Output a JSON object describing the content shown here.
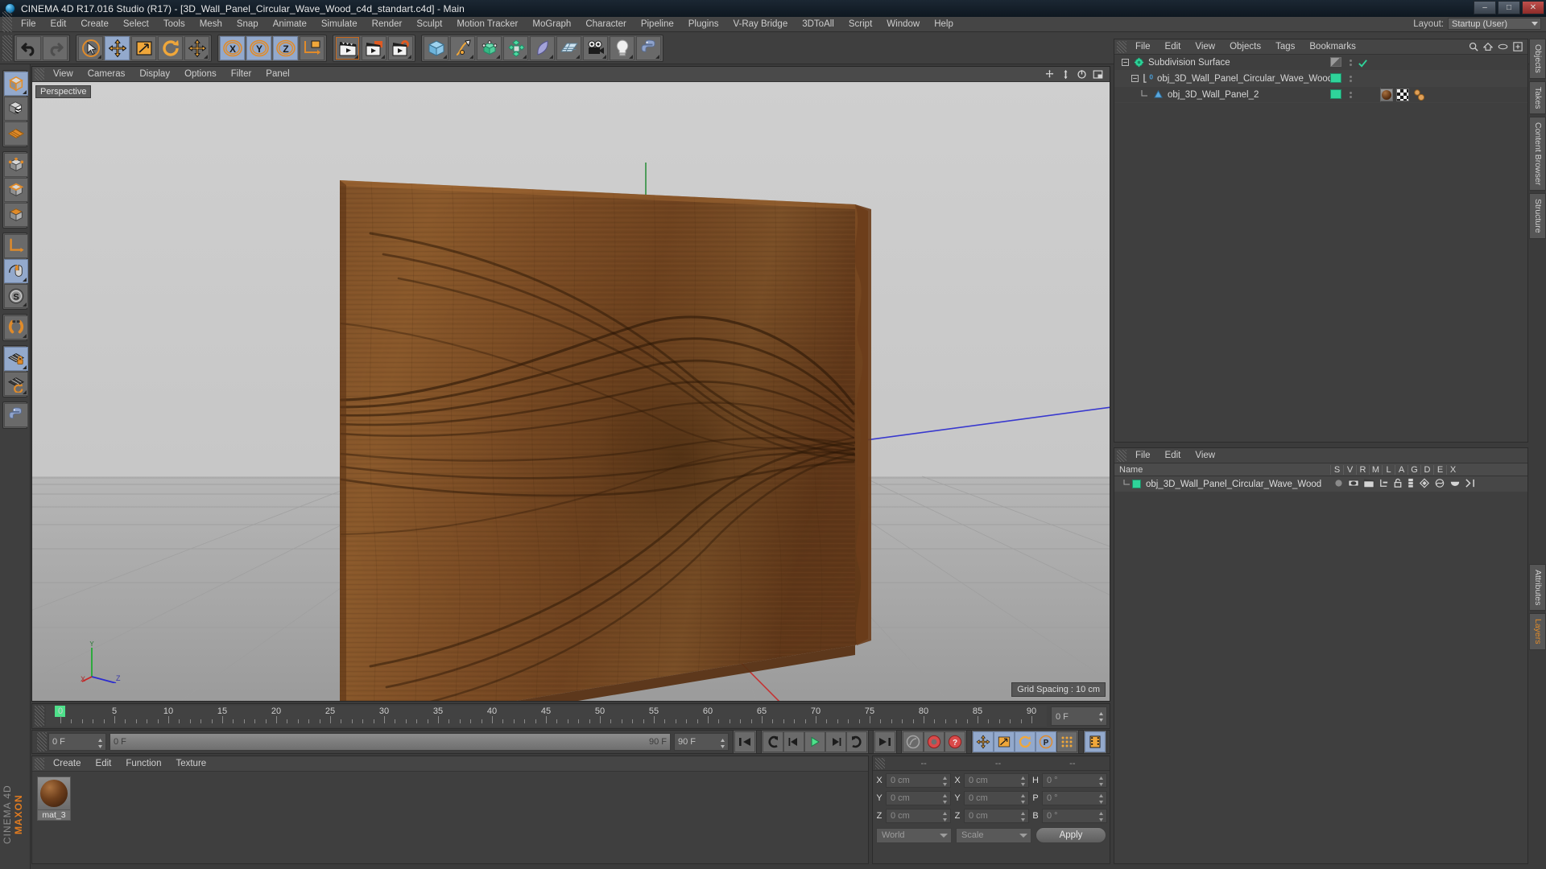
{
  "window": {
    "title": "CINEMA 4D R17.016 Studio (R17) - [3D_Wall_Panel_Circular_Wave_Wood_c4d_standart.c4d] - Main",
    "minimize": "–",
    "maximize": "□",
    "close": "✕"
  },
  "menubar": {
    "items": [
      "File",
      "Edit",
      "Create",
      "Select",
      "Tools",
      "Mesh",
      "Snap",
      "Animate",
      "Simulate",
      "Render",
      "Sculpt",
      "Motion Tracker",
      "MoGraph",
      "Character",
      "Pipeline",
      "Plugins",
      "V-Ray Bridge",
      "3DToAll",
      "Script",
      "Window",
      "Help"
    ],
    "layout_label": "Layout:",
    "layout_value": "Startup (User)"
  },
  "toolbar": {
    "undo": "undo-tool",
    "redo": "redo-tool",
    "live_select": "Live Selection",
    "move": "Move",
    "scale": "Scale",
    "rotate": "Rotate",
    "axis_x": "X",
    "axis_y": "Y",
    "axis_z": "Z",
    "world_object": "World/Object Coordinate System",
    "render_view": "Render View",
    "render_region": "Render to Picture Viewer",
    "render_settings": "Edit Render Settings",
    "primitives": "Cube",
    "spline": "Spline Pen",
    "generators": "Generators",
    "mograph": "MoGraph",
    "deformers": "Deformers",
    "scene": "Scene",
    "camera": "Camera",
    "light": "Light",
    "python": "Python Generator"
  },
  "left_toolbar": {
    "items": [
      "make-editable-icon",
      "model-mode-icon",
      "texture-mode-icon",
      "workplane-icon",
      "points-mode-icon",
      "edges-mode-icon",
      "polygons-mode-icon",
      "object-axis-icon",
      "viewport-solo-icon",
      "enable-snap-icon",
      "snap-magnet-icon",
      "workplane-lock-icon",
      "planar-workplane-icon",
      "python-icon"
    ],
    "brand_top": "MAXON",
    "brand_bottom": "CINEMA 4D"
  },
  "viewport": {
    "menu": [
      "View",
      "Cameras",
      "Display",
      "Options",
      "Filter",
      "Panel"
    ],
    "label": "Perspective",
    "grid_spacing": "Grid Spacing : 10 cm",
    "axis_labels": {
      "y": "Y",
      "x": "X",
      "z": "Z"
    },
    "icons": [
      "move-view-icon",
      "pan-view-icon",
      "rotate-view-icon",
      "maximize-view-icon"
    ]
  },
  "timeline": {
    "ticks": [
      0,
      5,
      10,
      15,
      20,
      25,
      30,
      35,
      40,
      45,
      50,
      55,
      60,
      65,
      70,
      75,
      80,
      85,
      90
    ],
    "min_frame": 0,
    "max_frame": 90,
    "current_frame_field": "0 F",
    "current_frame_slider": "0 F",
    "end_slider": "90 F",
    "preview_end": "90 F",
    "right_frame_field": "0 F"
  },
  "animbar": {
    "buttons": [
      "go-to-start",
      "play-backwards-keyframe",
      "step-backward",
      "play",
      "step-forward",
      "play-forward-keyframe",
      "go-to-end",
      "autokey",
      "record-active-objects",
      "record-question"
    ],
    "modes": [
      "move-key-icon",
      "scale-key-icon",
      "rotate-key-icon",
      "parameter-key-icon",
      "point-level-key-icon",
      "timeline-icon"
    ]
  },
  "material_manager": {
    "menu": [
      "Create",
      "Edit",
      "Function",
      "Texture"
    ],
    "materials": [
      {
        "name": "mat_3",
        "color": "#6e3f1c"
      }
    ]
  },
  "coordinates": {
    "headers": [
      "--",
      "--",
      "--"
    ],
    "rows": [
      {
        "pos_label": "X",
        "pos_value": "0 cm",
        "size_label": "X",
        "size_value": "0 cm",
        "rot_label": "H",
        "rot_value": "0 °"
      },
      {
        "pos_label": "Y",
        "pos_value": "0 cm",
        "size_label": "Y",
        "size_value": "0 cm",
        "rot_label": "P",
        "rot_value": "0 °"
      },
      {
        "pos_label": "Z",
        "pos_value": "0 cm",
        "size_label": "Z",
        "size_value": "0 cm",
        "rot_label": "B",
        "rot_value": "0 °"
      }
    ],
    "system": "World",
    "mode": "Scale",
    "apply": "Apply"
  },
  "object_manager": {
    "menu": [
      "File",
      "Edit",
      "View",
      "Objects",
      "Tags",
      "Bookmarks"
    ],
    "icons": [
      "search-icon",
      "home-icon",
      "eye-icon",
      "new-window-icon"
    ],
    "tree": [
      {
        "name": "Subdivision Surface",
        "depth": 0,
        "icon": "subdivision-surface-icon",
        "vis": "half",
        "check": true
      },
      {
        "name": "obj_3D_Wall_Panel_Circular_Wave_Wood",
        "depth": 1,
        "icon": "null-layer-icon",
        "vis": "green",
        "check": false
      },
      {
        "name": "obj_3D_Wall_Panel_2",
        "depth": 2,
        "icon": "polygon-object-icon",
        "vis": "green",
        "check": false,
        "tags": [
          "material-tag",
          "uvw-tag",
          "selection-tag"
        ]
      }
    ]
  },
  "layer_manager": {
    "menu": [
      "File",
      "Edit",
      "View"
    ],
    "columns": [
      "Name",
      "S",
      "V",
      "R",
      "M",
      "L",
      "A",
      "G",
      "D",
      "E",
      "X"
    ],
    "rows": [
      {
        "name": "obj_3D_Wall_Panel_Circular_Wave_Wood",
        "color": "#2fd49a"
      }
    ]
  },
  "right_tabs": [
    "Objects",
    "Takes",
    "Content Browser",
    "Structure",
    "Attributes",
    "Layers"
  ],
  "colors": {
    "accent_orange": "#e08b2a",
    "green": "#2fd49a",
    "selected_blue": "#93a9cc",
    "panel_bg": "#3f3f3f",
    "wood": "#6e3f1c"
  }
}
